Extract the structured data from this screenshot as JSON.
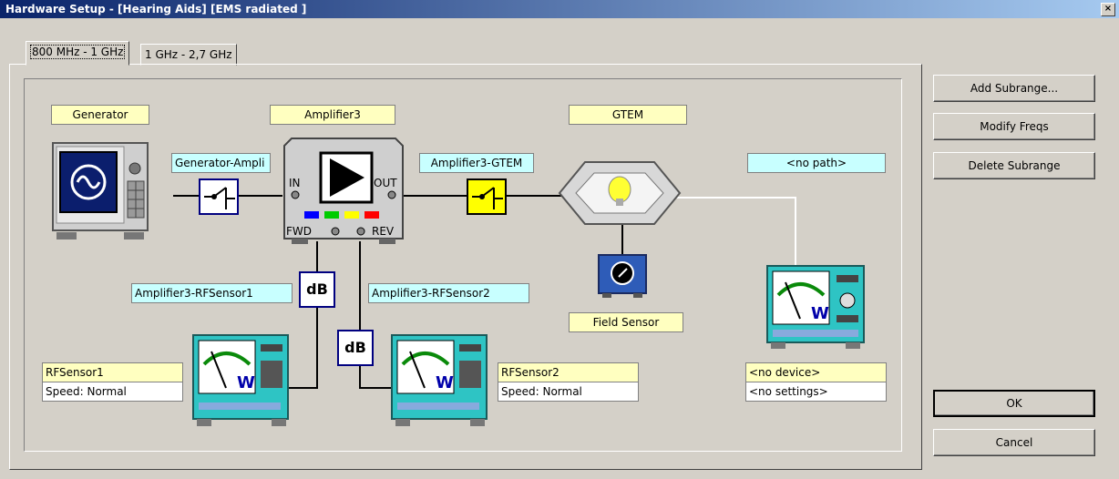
{
  "window": {
    "title": "Hardware Setup  -  [Hearing Aids] [EMS radiated ]",
    "close_glyph": "×"
  },
  "tabs": [
    {
      "label": "800 MHz - 1 GHz",
      "active": true
    },
    {
      "label": "1 GHz - 2,7 GHz",
      "active": false
    }
  ],
  "devices": {
    "generator": "Generator",
    "amplifier": "Amplifier3",
    "gtem": "GTEM",
    "field_sensor": "Field Sensor",
    "rfsensor1": {
      "name": "RFSensor1",
      "settings": "Speed: Normal"
    },
    "rfsensor2": {
      "name": "RFSensor2",
      "settings": "Speed: Normal"
    },
    "no_device": {
      "name": "<no device>",
      "settings": "<no settings>"
    }
  },
  "paths": {
    "gen_amp": "Generator-Ampli",
    "amp_gtem": "Amplifier3-GTEM",
    "amp_rf1": "Amplifier3-RFSensor1",
    "amp_rf2": "Amplifier3-RFSensor2",
    "no_path": "<no path>"
  },
  "amplifier_ports": {
    "in": "IN",
    "out": "OUT",
    "fwd": "FWD",
    "rev": "REV"
  },
  "attenuator_label": "dB",
  "buttons": {
    "add_subrange": "Add Subrange...",
    "modify_freqs": "Modify Freqs",
    "delete_subrange": "Delete Subrange",
    "ok": "OK",
    "cancel": "Cancel"
  },
  "colors": {
    "title_start": "#0a246a",
    "device_label": "#ffffc0",
    "path_label": "#c8ffff",
    "meter_body": "#2ec4c4",
    "switch_yellow": "#ffff00"
  }
}
